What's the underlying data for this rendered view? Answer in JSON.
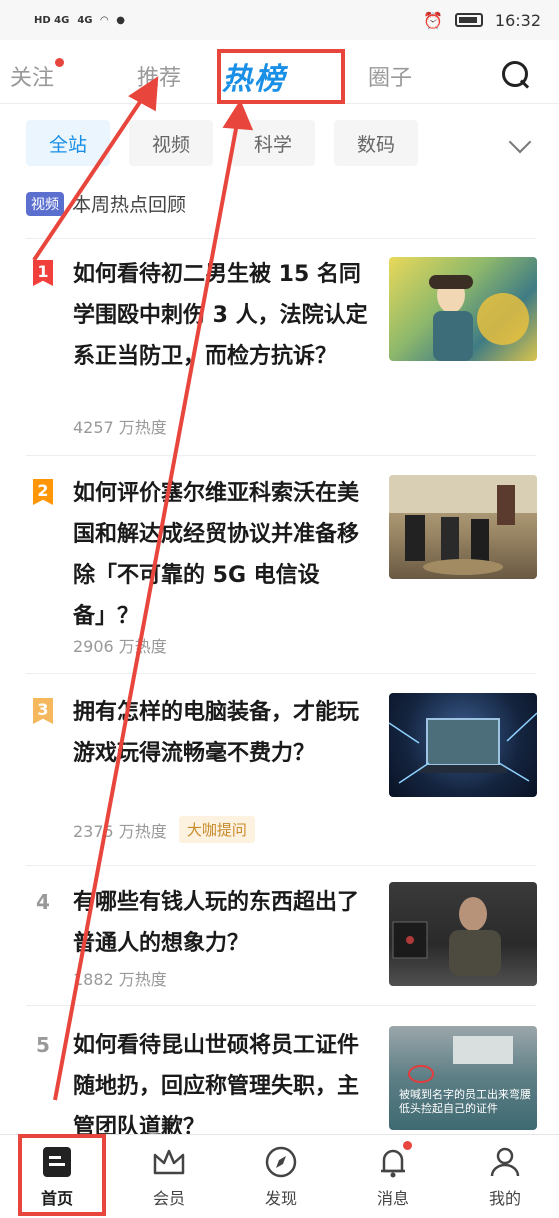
{
  "status_bar": {
    "time": "16:32",
    "signal_left": "HD 4G",
    "signal_right": "4G"
  },
  "top_nav": {
    "tabs": [
      {
        "label": "关注"
      },
      {
        "label": "推荐"
      },
      {
        "label": "热榜"
      },
      {
        "label": "圈子"
      }
    ]
  },
  "filters": [
    {
      "label": "全站"
    },
    {
      "label": "视频"
    },
    {
      "label": "科学"
    },
    {
      "label": "数码"
    }
  ],
  "weekly": {
    "badge": "视频",
    "label": "本周热点回顾"
  },
  "feed": [
    {
      "rank": "1",
      "title": "如何看待初二男生被 15 名同学围殴中刺伤 3 人，法院认定系正当防卫，而检方抗诉？",
      "heat": "4257 万热度"
    },
    {
      "rank": "2",
      "title": "如何评价塞尔维亚科索沃在美国和解达成经贸协议并准备移除「不可靠的 5G 电信设备」？",
      "heat": "2906 万热度"
    },
    {
      "rank": "3",
      "title": "拥有怎样的电脑装备，才能玩游戏玩得流畅毫不费力？",
      "heat": "2375 万热度",
      "tag": "大咖提问"
    },
    {
      "rank": "4",
      "title": "有哪些有钱人玩的东西超出了普通人的想象力？",
      "heat": "1882 万热度"
    },
    {
      "rank": "5",
      "title": "如何看待昆山世硕将员工证件随地扔，回应称管理失职，主管团队道歉？",
      "heat": "",
      "thumb_caption": "被喊到名字的员工出来弯腰低头捡起自己的证件"
    }
  ],
  "bottom_bar": [
    {
      "label": "首页",
      "icon": "home-icon"
    },
    {
      "label": "会员",
      "icon": "crown-icon"
    },
    {
      "label": "发现",
      "icon": "compass-icon"
    },
    {
      "label": "消息",
      "icon": "bell-icon"
    },
    {
      "label": "我的",
      "icon": "person-icon"
    }
  ],
  "colors": {
    "accent": "#1a8fe6",
    "annotation": "#e8453c"
  }
}
